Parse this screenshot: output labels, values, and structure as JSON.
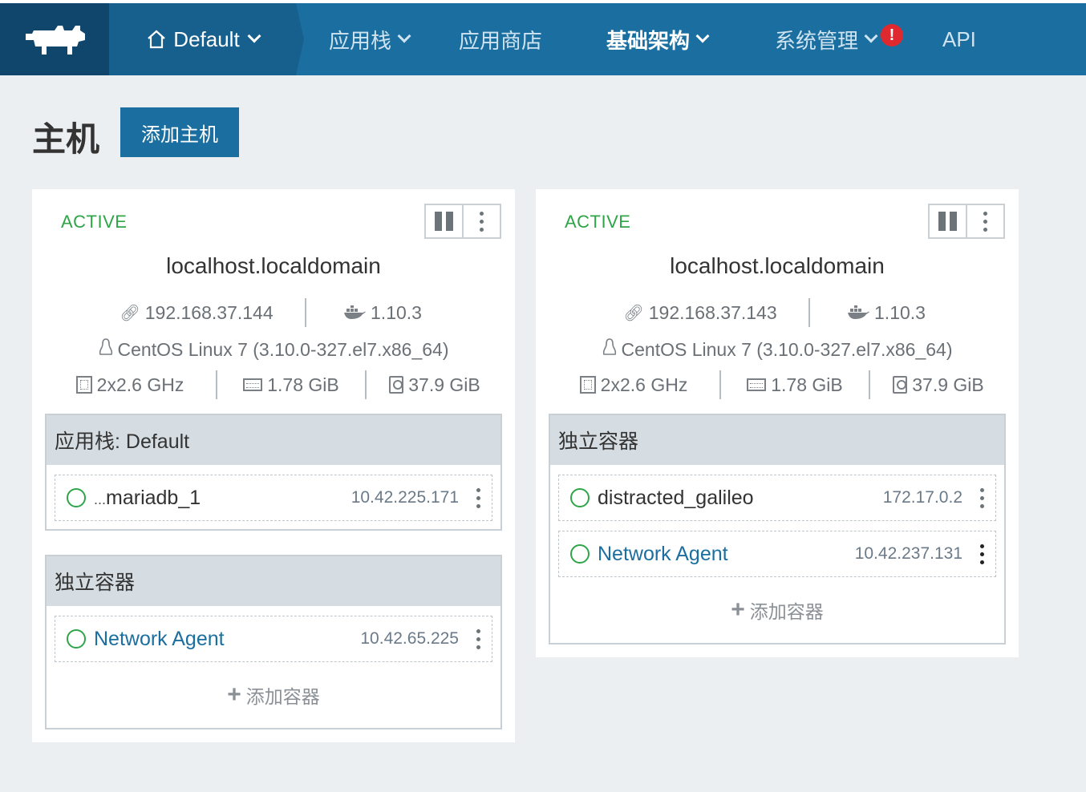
{
  "nav": {
    "environment": "Default",
    "items": [
      {
        "label": "应用栈",
        "dropdown": true
      },
      {
        "label": "应用商店",
        "dropdown": false
      },
      {
        "label": "基础架构",
        "dropdown": true,
        "active": true
      },
      {
        "label": "系统管理",
        "dropdown": true,
        "alert": "!"
      },
      {
        "label": "API",
        "dropdown": false
      }
    ]
  },
  "page": {
    "title": "主机",
    "add_host_label": "添加主机"
  },
  "hosts": [
    {
      "state": "ACTIVE",
      "hostname": "localhost.localdomain",
      "ip": "192.168.37.144",
      "docker_version": "1.10.3",
      "os": "CentOS Linux 7 (3.10.0-327.el7.x86_64)",
      "cpu": "2x2.6 GHz",
      "memory": "1.78 GiB",
      "disk": "37.9 GiB",
      "groups": [
        {
          "header": "应用栈: Default",
          "containers": [
            {
              "ellipsis": "...",
              "name": "mariadb_1",
              "ip": "10.42.225.171"
            }
          ]
        },
        {
          "header": "独立容器",
          "containers": [
            {
              "name": "Network Agent",
              "ip": "10.42.65.225"
            }
          ],
          "add_label": "添加容器"
        }
      ]
    },
    {
      "state": "ACTIVE",
      "hostname": "localhost.localdomain",
      "ip": "192.168.37.143",
      "docker_version": "1.10.3",
      "os": "CentOS Linux 7 (3.10.0-327.el7.x86_64)",
      "cpu": "2x2.6 GHz",
      "memory": "1.78 GiB",
      "disk": "37.9 GiB",
      "groups": [
        {
          "header": "独立容器",
          "containers": [
            {
              "name": "distracted_galileo",
              "ip": "172.17.0.2"
            },
            {
              "name": "Network Agent",
              "ip": "10.42.237.131"
            }
          ],
          "add_label": "添加容器"
        }
      ]
    }
  ],
  "colors": {
    "topbar": "#1b6fa0",
    "logo_bg": "#10466b",
    "active_state": "#2fa448",
    "alert": "#e0292f"
  }
}
